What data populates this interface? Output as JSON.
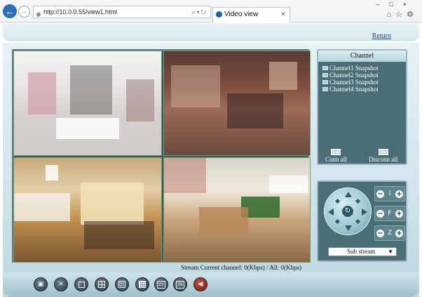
{
  "browser": {
    "url": "http://10.0.0.55/view1.html",
    "tab_title": "Video view",
    "tab_close": "×",
    "window_buttons": "–□×",
    "tool_icons": [
      "home-icon",
      "star-icon",
      "gear-icon"
    ]
  },
  "header": {
    "return_label": "Return"
  },
  "channel_panel": {
    "title": "Channel",
    "items": [
      {
        "label": "Channel1 Snapshot"
      },
      {
        "label": "Channel2 Snapshot"
      },
      {
        "label": "Channel3 Snapshot"
      },
      {
        "label": "Channel4 Snapshot"
      }
    ],
    "connect_all_label": "Conn all",
    "disconnect_all_label": "Disconn all"
  },
  "ptz": {
    "iris_label": "I",
    "focus_label": "F",
    "zoom_label": "Z",
    "minus": "−",
    "plus": "+",
    "center_glyph": "↻",
    "stream_select": "Sub stream"
  },
  "status": {
    "stream_text": "Stream Current channel: 0(Kbps) / All: 0(Kbps)"
  },
  "toolbar": {
    "buttons": [
      {
        "icon": "video-record-icon",
        "glyph": "▣"
      },
      {
        "icon": "settings-tools-icon",
        "glyph": "✕"
      },
      {
        "icon": "single-view-icon"
      },
      {
        "icon": "quad-view-icon"
      },
      {
        "icon": "nine-view-icon"
      },
      {
        "icon": "sixteen-view-icon"
      },
      {
        "icon": "view-25-icon",
        "label": "25"
      },
      {
        "icon": "view-36-icon",
        "label": "36"
      },
      {
        "icon": "audio-icon",
        "glyph": "◀"
      }
    ]
  },
  "colors": {
    "panel_bg": "#4b6d76",
    "frame_bg": "#cfe3ea",
    "link": "#1f43a8",
    "browser_back": "#2d6fb6"
  }
}
